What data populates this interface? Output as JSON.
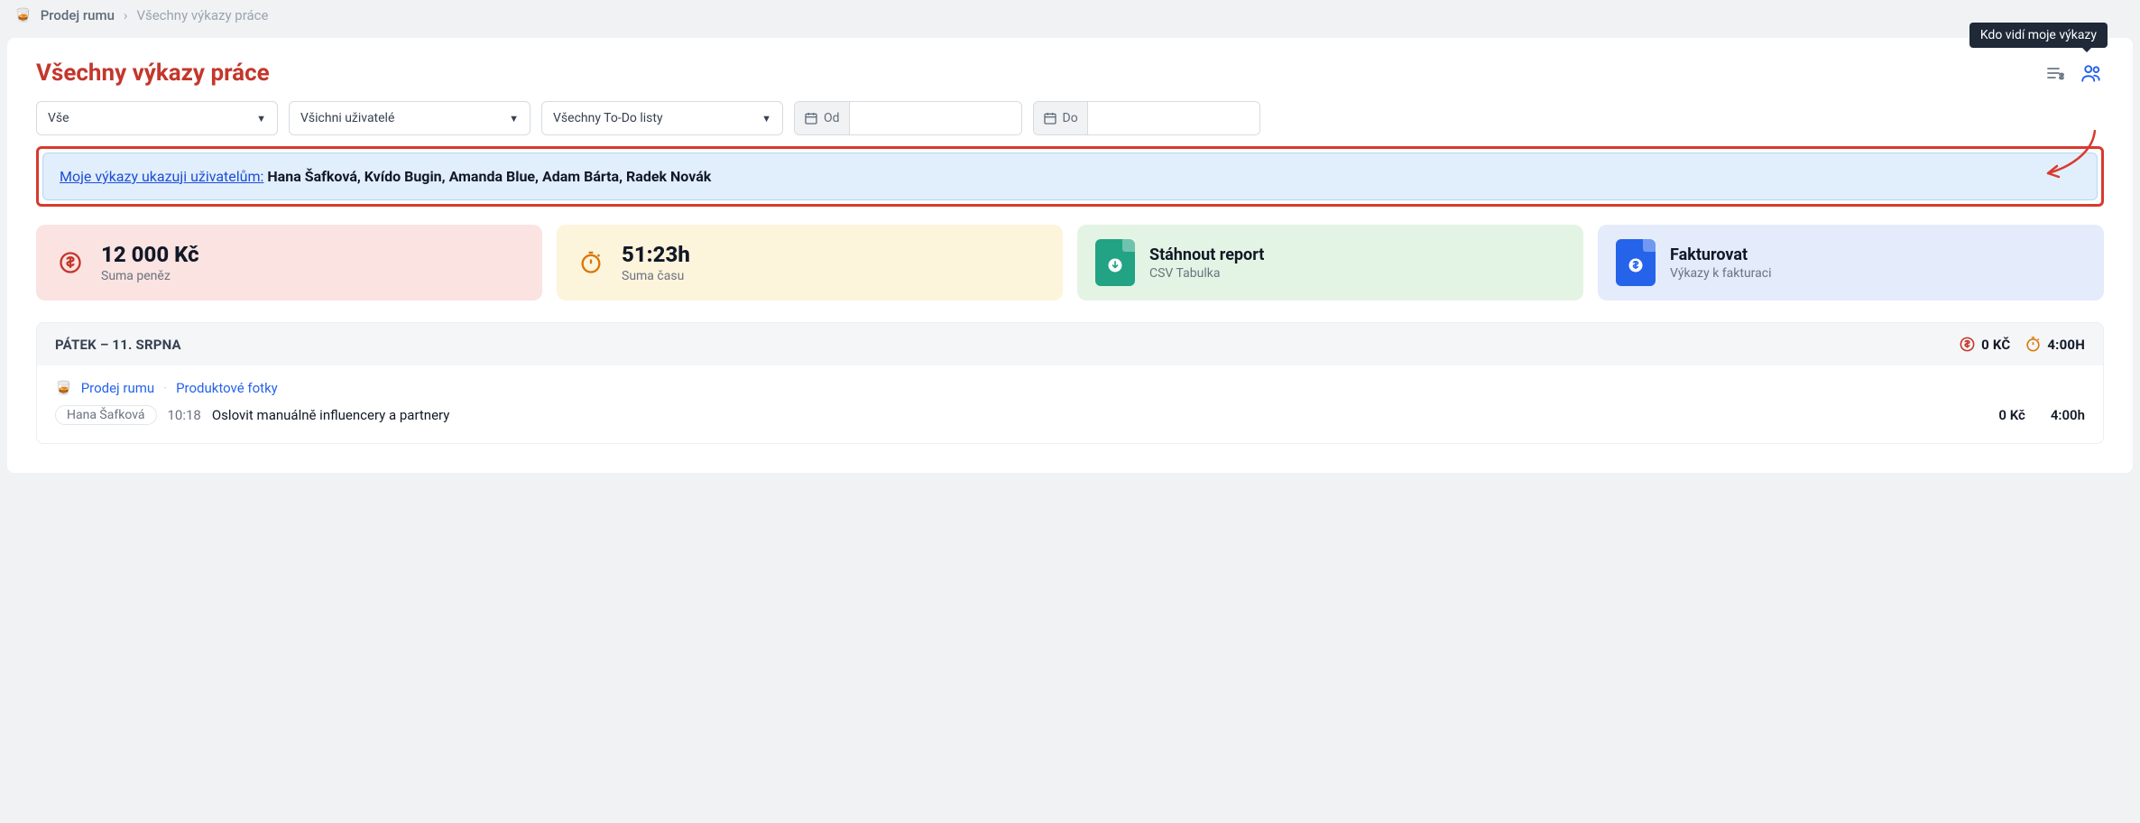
{
  "breadcrumb": {
    "emoji": "🥃",
    "project": "Prodej rumu",
    "current": "Všechny výkazy práce"
  },
  "header": {
    "title": "Všechny výkazy práce",
    "tooltip": "Kdo vidí moje výkazy"
  },
  "filters": {
    "scope": "Vše",
    "users": "Všichni uživatelé",
    "todos": "Všechny To-Do listy",
    "from_label": "Od",
    "to_label": "Do",
    "from_value": "",
    "to_value": ""
  },
  "banner": {
    "link": "Moje výkazy ukazuji uživatelům:",
    "names": "Hana Šafková, Kvído Bugin, Amanda Blue, Adam Bárta, Radek Novák"
  },
  "stats": {
    "money": {
      "value": "12 000 Kč",
      "label": "Suma peněz"
    },
    "time": {
      "value": "51:23h",
      "label": "Suma času"
    },
    "download": {
      "title": "Stáhnout report",
      "subtitle": "CSV Tabulka"
    },
    "invoice": {
      "title": "Fakturovat",
      "subtitle": "Výkazy k fakturaci"
    }
  },
  "day": {
    "label": "Pátek – 11. srpna",
    "money": "0 Kč",
    "time": "4:00h"
  },
  "entry": {
    "emoji": "🥃",
    "project": "Prodej rumu",
    "task": "Produktové fotky",
    "user": "Hana Šafková",
    "at": "10:18",
    "desc": "Oslovit manuálně influencery a partnery",
    "money": "0 Kč",
    "time": "4:00h"
  }
}
